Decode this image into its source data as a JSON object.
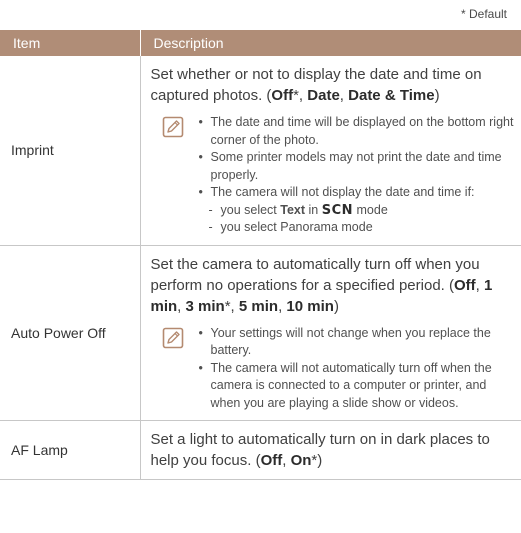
{
  "default_note": "* Default",
  "header": {
    "item": "Item",
    "description": "Description"
  },
  "rows": [
    {
      "item": "Imprint",
      "desc_text": "Set whether or not to display the date and time on captured photos. (",
      "options": [
        "Off",
        "*, ",
        "Date",
        ", ",
        "Date & Time",
        ")"
      ],
      "notes": [
        "The date and time will be displayed on the bottom right corner of the photo.",
        "Some printer models may not print the date and time properly.",
        "The camera will not display the date and time if:"
      ],
      "subnotes": [
        {
          "prefix": "you select ",
          "bold": "Text",
          "middle": " in ",
          "mode": "SCN",
          "suffix": " mode"
        },
        {
          "text": "you select Panorama mode"
        }
      ]
    },
    {
      "item": "Auto Power Off",
      "desc_text": "Set the camera to automatically turn off when you perform no operations for a specified period. (",
      "options": [
        "Off",
        ", ",
        "1 min",
        ", ",
        "3 min",
        "*, ",
        "5 min",
        ", ",
        "10 min",
        ")"
      ],
      "notes": [
        "Your settings will not change when you replace the battery.",
        "The camera will not automatically turn off when the camera is connected to a computer or printer, and when you are playing a slide show or videos."
      ]
    },
    {
      "item": "AF Lamp",
      "desc_text": "Set a light to automatically turn on in dark places to help you focus. (",
      "options": [
        "Off",
        ", ",
        "On",
        "*)"
      ]
    }
  ],
  "colors": {
    "header_bg": "#b08d77",
    "header_text": "#ffffff",
    "border": "#c7c7c7",
    "icon": "#b48a70"
  },
  "icons": {
    "note": "pencil-note-icon"
  }
}
